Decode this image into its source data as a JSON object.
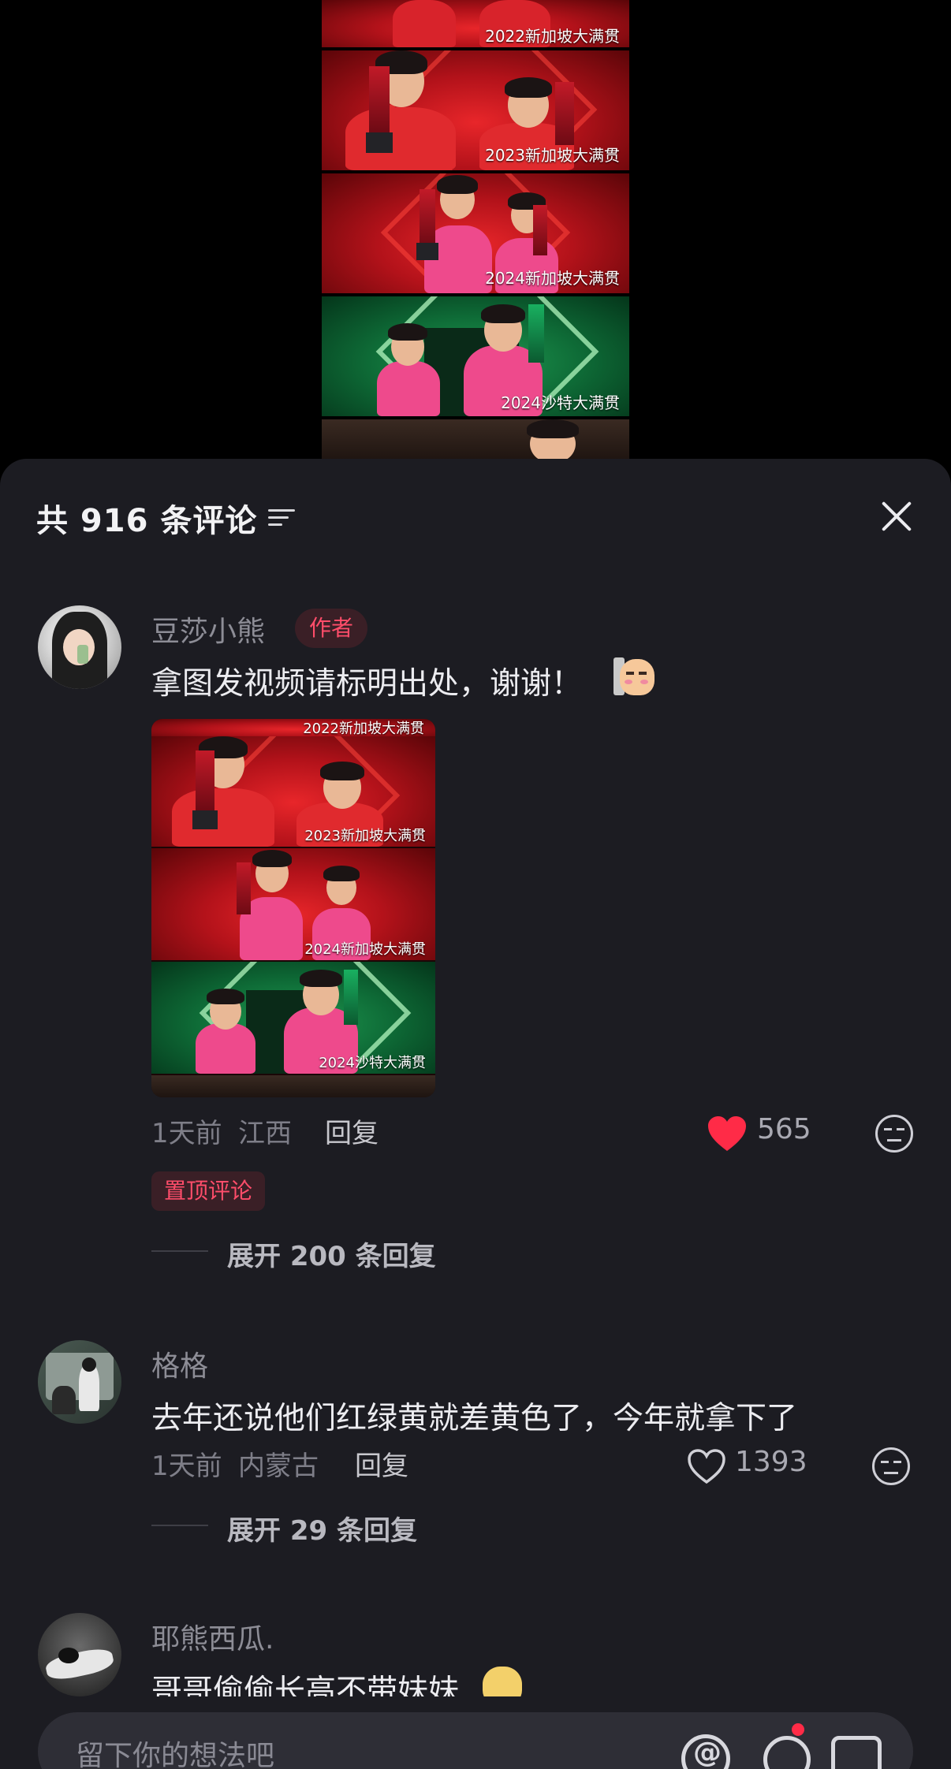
{
  "video": {
    "captions": [
      "2022新加坡大满贯",
      "2023新加坡大满贯",
      "2024新加坡大满贯",
      "2024沙特大满贯"
    ]
  },
  "sheet": {
    "title": "共 916 条评论",
    "sort_icon": "sort-lines-icon",
    "close_icon": "close-icon"
  },
  "comments": [
    {
      "username": "豆莎小熊",
      "badge": "作者",
      "text": "拿图发视频请标明出处，谢谢！",
      "emoji": "sticker-emoji",
      "image_captions": [
        "2022新加坡大满贯",
        "2023新加坡大满贯",
        "2024新加坡大满贯",
        "2024沙特大满贯"
      ],
      "time": "1天前",
      "location": "江西",
      "reply": "回复",
      "likes": "565",
      "liked": true,
      "pinned": "置顶评论",
      "expand": "展开 200 条回复"
    },
    {
      "username": "格格",
      "text": "去年还说他们红绿黄就差黄色了，今年就拿下了",
      "time": "1天前",
      "location": "内蒙古",
      "reply": "回复",
      "likes": "1393",
      "liked": false,
      "expand": "展开 29 条回复"
    },
    {
      "username": "耶熊西瓜.",
      "text": "哥哥偷偷长高不带妹妹"
    }
  ],
  "input": {
    "placeholder": "留下你的想法吧",
    "icons": [
      "at-icon",
      "emoji-icon",
      "image-icon"
    ]
  },
  "colors": {
    "sheet_bg": "#1c1c22",
    "accent_red": "#ff2b47",
    "badge_text": "#ff4d6a"
  }
}
